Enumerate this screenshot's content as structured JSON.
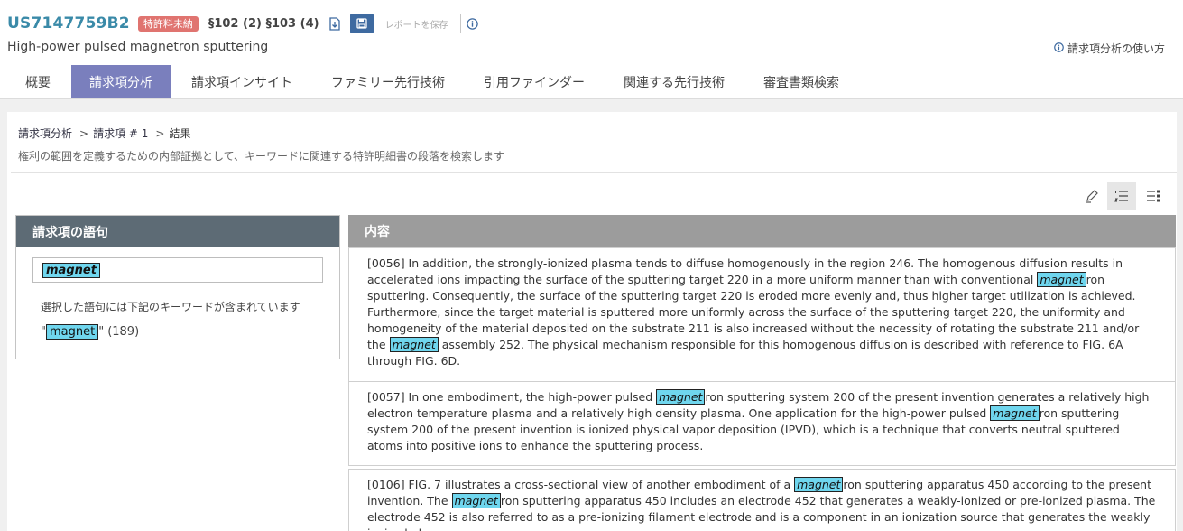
{
  "header": {
    "patent_number": "US7147759B2",
    "fee_badge": "特許料未納",
    "sections": "§102 (2) §103 (4)",
    "save_report_label": "レポートを保存",
    "subtitle": "High-power pulsed magnetron sputtering",
    "howto_label": "請求項分析の使い方"
  },
  "tabs": [
    {
      "label": "概要"
    },
    {
      "label": "請求項分析"
    },
    {
      "label": "請求項インサイト"
    },
    {
      "label": "ファミリー先行技術"
    },
    {
      "label": "引用ファインダー"
    },
    {
      "label": "関連する先行技術"
    },
    {
      "label": "審査書類検索"
    }
  ],
  "breadcrumb": {
    "root": "請求項分析",
    "claim": "請求項 # 1",
    "current": "結果"
  },
  "description": "権利の範囲を定義するための内部証拠として、キーワードに関連する特許明細書の段落を検索します",
  "left_panel": {
    "title": "請求項の語句",
    "term": "magnet",
    "contains_label": "選択した語句には下記のキーワードが含まれています",
    "keyword": "magnet",
    "keyword_count": "(189)"
  },
  "right_panel": {
    "title": "内容"
  },
  "paragraphs": [
    {
      "segments": [
        {
          "t": "[0056] In addition, the strongly-ionized plasma tends to diffuse homogenously in the region 246. The homogenous diffusion results in accelerated ions impacting the surface of the sputtering target 220 in a more uniform manner than with conventional "
        },
        {
          "t": "magnet",
          "hl": true
        },
        {
          "t": "ron sputtering. Consequently, the surface of the sputtering target 220 is eroded more evenly and, thus higher target utilization is achieved. Furthermore, since the target material is sputtered more uniformly across the surface of the sputtering target 220, the uniformity and homogeneity of the material deposited on the substrate 211 is also increased without the necessity of rotating the substrate 211 and/or the "
        },
        {
          "t": "magnet",
          "hl": true
        },
        {
          "t": " assembly 252. The physical mechanism responsible for this homogenous diffusion is described with reference to FIG. 6A through FIG. 6D."
        }
      ]
    },
    {
      "segments": [
        {
          "t": "[0057] In one embodiment, the high-power pulsed "
        },
        {
          "t": "magnet",
          "hl": true
        },
        {
          "t": "ron sputtering system 200 of the present invention generates a relatively high electron temperature plasma and a relatively high density plasma. One application for the high-power pulsed "
        },
        {
          "t": "magnet",
          "hl": true
        },
        {
          "t": "ron sputtering system 200 of the present invention is ionized physical vapor deposition (IPVD), which is a technique that converts neutral sputtered atoms into positive ions to enhance the sputtering process."
        }
      ]
    },
    {
      "segments": [
        {
          "t": "[0106] FIG. 7 illustrates a cross-sectional view of another embodiment of a "
        },
        {
          "t": "magnet",
          "hl": true
        },
        {
          "t": "ron sputtering apparatus 450 according to the present invention. The "
        },
        {
          "t": "magnet",
          "hl": true
        },
        {
          "t": "ron sputtering apparatus 450 includes an electrode 452 that generates a weakly-ionized or pre-ionized plasma. The electrode 452 is also referred to as a pre-ionizing filament electrode and is a component in an ionization source that generates the weakly ionized plasma."
        }
      ]
    }
  ],
  "colors": {
    "accent_tab": "#7a7fbd",
    "patent_number": "#3a8aa8",
    "fee_badge": "#e07470",
    "keyword_highlight": "#6fd6ee",
    "left_header": "#5d6b75",
    "right_header": "#9c9c9c"
  },
  "icons": [
    "download-pdf-icon",
    "save-disk-icon",
    "info-icon",
    "highlighter-icon",
    "numbered-list-icon",
    "detail-list-icon"
  ]
}
